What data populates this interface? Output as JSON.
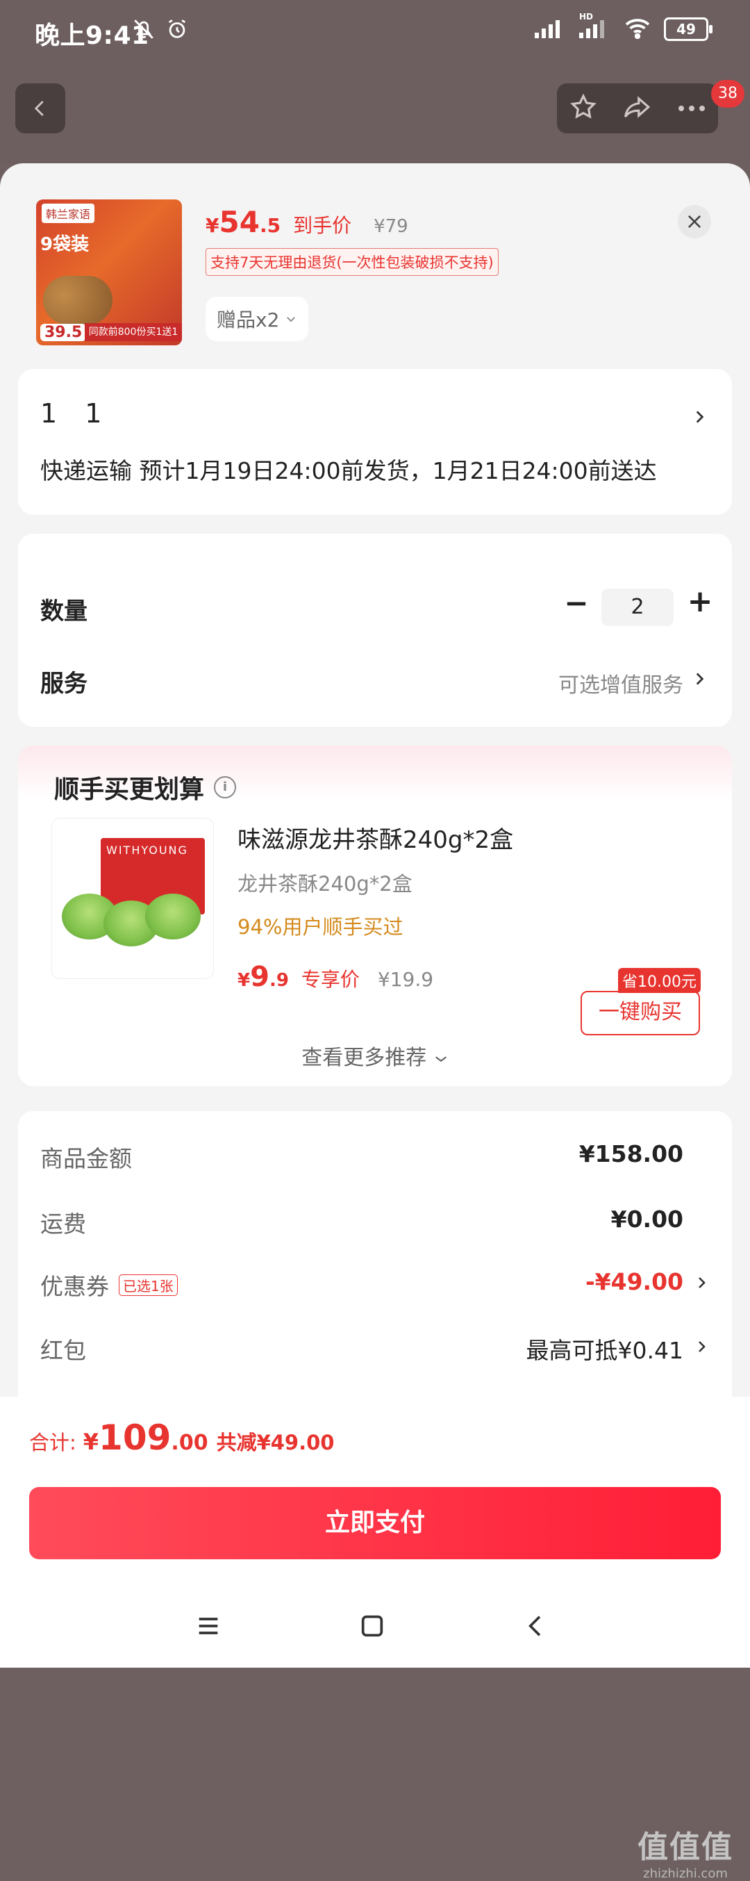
{
  "status_bar": {
    "time": "晚上9:41",
    "battery": "49",
    "network": "HD"
  },
  "top_nav": {
    "badge_count": "38"
  },
  "product": {
    "image_texts": {
      "brand": "韩兰家语",
      "pack": "9袋装",
      "promo": "同款前800份买1送1",
      "price": "39.5"
    },
    "price_yen": "¥",
    "price_int": "54",
    "price_dec": ".5",
    "price_label": "到手价",
    "original_price": "¥79",
    "return_policy": "支持7天无理由退货(一次性包装破损不支持)",
    "gift_label": "赠品x2"
  },
  "address": {
    "name": "1 1",
    "shipping": "快递运输 预计1月19日24:00前发货，1月21日24:00前送达"
  },
  "quantity": {
    "label": "数量",
    "value": "2",
    "minus": "−",
    "plus": "+"
  },
  "service": {
    "label": "服务",
    "value": "可选增值服务"
  },
  "recommend": {
    "title": "顺手买更划算",
    "item": {
      "image_text": "WITHYOUNG",
      "name": "味滋源龙井茶酥240g*2盒",
      "spec": "龙井茶酥240g*2盒",
      "buyers": "94%用户顺手买过",
      "price_yen": "¥",
      "price_int": "9",
      "price_dec": ".9",
      "price_label": "专享价",
      "original_price": "¥19.9",
      "save_tag": "省10.00元",
      "buy_button": "一键购买"
    },
    "more": "查看更多推荐"
  },
  "summary": {
    "goods_label": "商品金额",
    "goods_value": "¥158.00",
    "shipping_label": "运费",
    "shipping_value": "¥0.00",
    "coupon_label": "优惠券",
    "coupon_tag": "已选1张",
    "coupon_value": "-¥49.00",
    "redpacket_label": "红包",
    "redpacket_value": "最高可抵¥0.41"
  },
  "footer": {
    "total_label": "合计:",
    "total_yen": "¥",
    "total_int": "109",
    "total_dec": ".00",
    "saving": "共减¥49.00",
    "pay_button": "立即支付"
  },
  "watermark": {
    "glyphs": "值值值",
    "site": "zhizhizhi.com"
  },
  "colors": {
    "accent": "#e8342f",
    "pay_gradient_start": "#ff4b5a",
    "pay_gradient_end": "#ff1e36",
    "buyers_orange": "#d48a1c"
  }
}
